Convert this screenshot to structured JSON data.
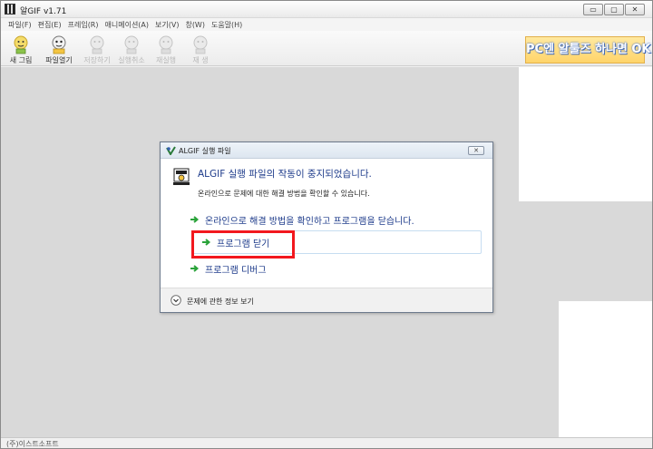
{
  "window": {
    "title": "알GIF v1.71",
    "controls": [
      "▭",
      "▢",
      "✕"
    ]
  },
  "menu": [
    "파일(F)",
    "편집(E)",
    "프레임(R)",
    "애니메이션(A)",
    "보기(V)",
    "창(W)",
    "도움말(H)"
  ],
  "toolbar": [
    {
      "label": "새 그림",
      "enabled": true
    },
    {
      "label": "파일열기",
      "enabled": true
    },
    {
      "label": "저장하기",
      "enabled": false
    },
    {
      "label": "실행취소",
      "enabled": false
    },
    {
      "label": "재실행",
      "enabled": false
    },
    {
      "label": "재 생",
      "enabled": false
    }
  ],
  "banner": {
    "text": "PC엔 알툴즈 하나면 OK"
  },
  "status": {
    "text": "(주)이스트소프트"
  },
  "dialog": {
    "title": "ALGIF 실행 파일",
    "close_label": "✕",
    "heading": "ALGIF 실행 파일의 작동이 중지되었습니다.",
    "subtext": "온라인으로 문제에 대한 해결 방법을 확인할 수 있습니다.",
    "options": {
      "online": "온라인으로 해결 방법을 확인하고 프로그램을 닫습니다.",
      "close": "프로그램 닫기",
      "debug": "프로그램 디버그"
    },
    "footer": "문제에 관한 정보 보기"
  },
  "colors": {
    "accent": "#1c3a8a",
    "highlight": "#f2181e",
    "arrow": "#2aa33a"
  }
}
